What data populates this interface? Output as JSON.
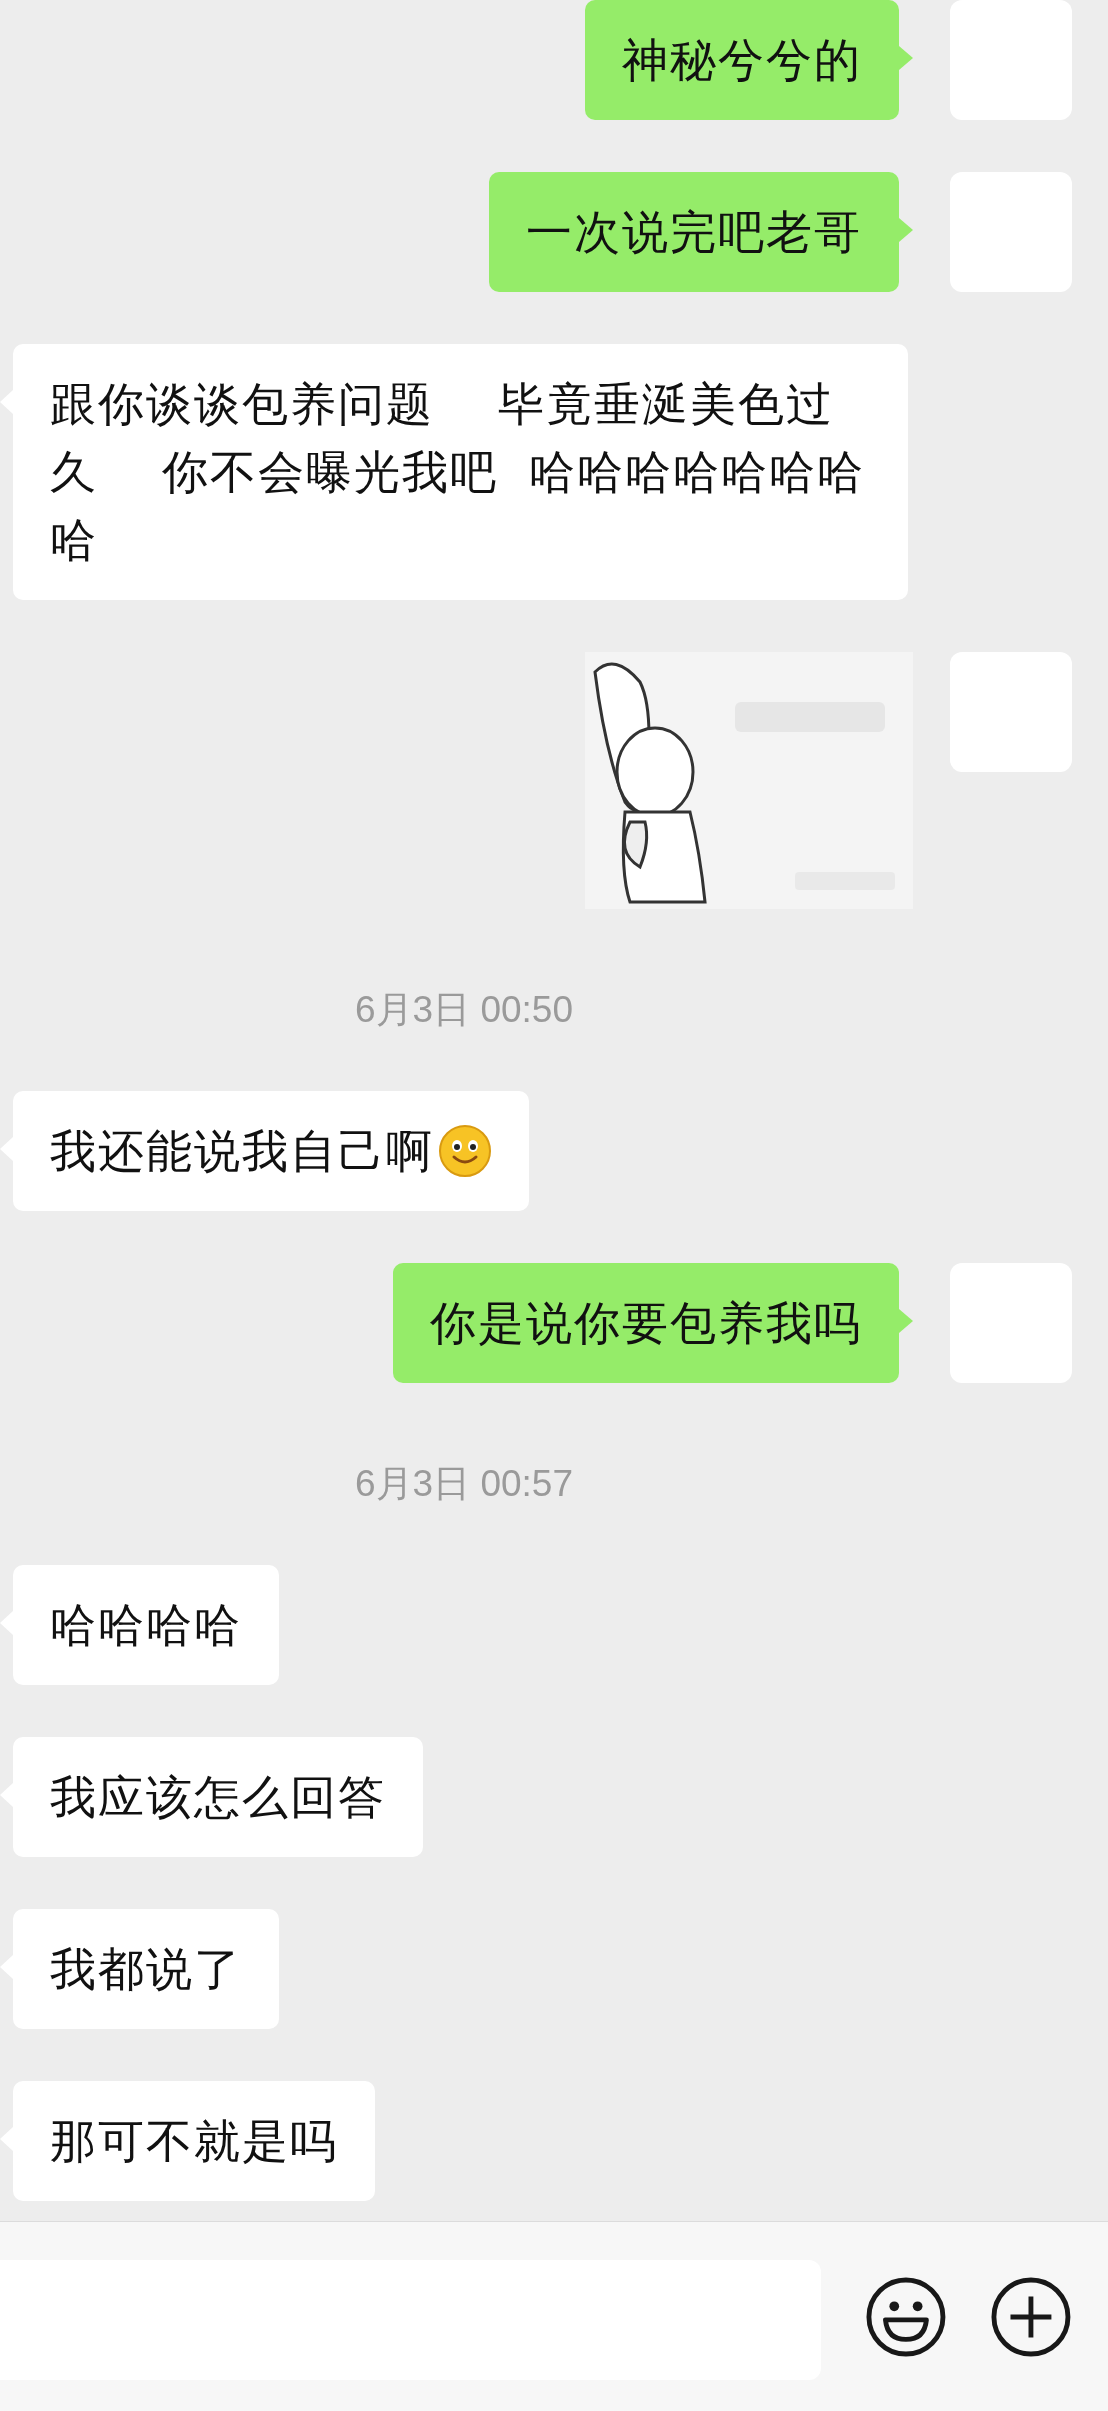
{
  "messages": [
    {
      "kind": "sent",
      "text": "神秘兮兮的"
    },
    {
      "kind": "sent",
      "text": "一次说完吧老哥"
    },
    {
      "kind": "received",
      "text": "跟你谈谈包养问题  毕竟垂涎美色过久  你不会曝光我吧 哈哈哈哈哈哈哈哈"
    },
    {
      "kind": "sticker"
    },
    {
      "kind": "time",
      "text": "6月3日 00:50"
    },
    {
      "kind": "received",
      "text": "我还能说我自己啊",
      "emoji": true
    },
    {
      "kind": "sent",
      "text": "你是说你要包养我吗"
    },
    {
      "kind": "time",
      "text": "6月3日 00:57"
    },
    {
      "kind": "received",
      "text": "哈哈哈哈"
    },
    {
      "kind": "received",
      "text": "我应该怎么回答"
    },
    {
      "kind": "received",
      "text": "我都说了"
    },
    {
      "kind": "received",
      "text": "那可不就是吗"
    }
  ]
}
